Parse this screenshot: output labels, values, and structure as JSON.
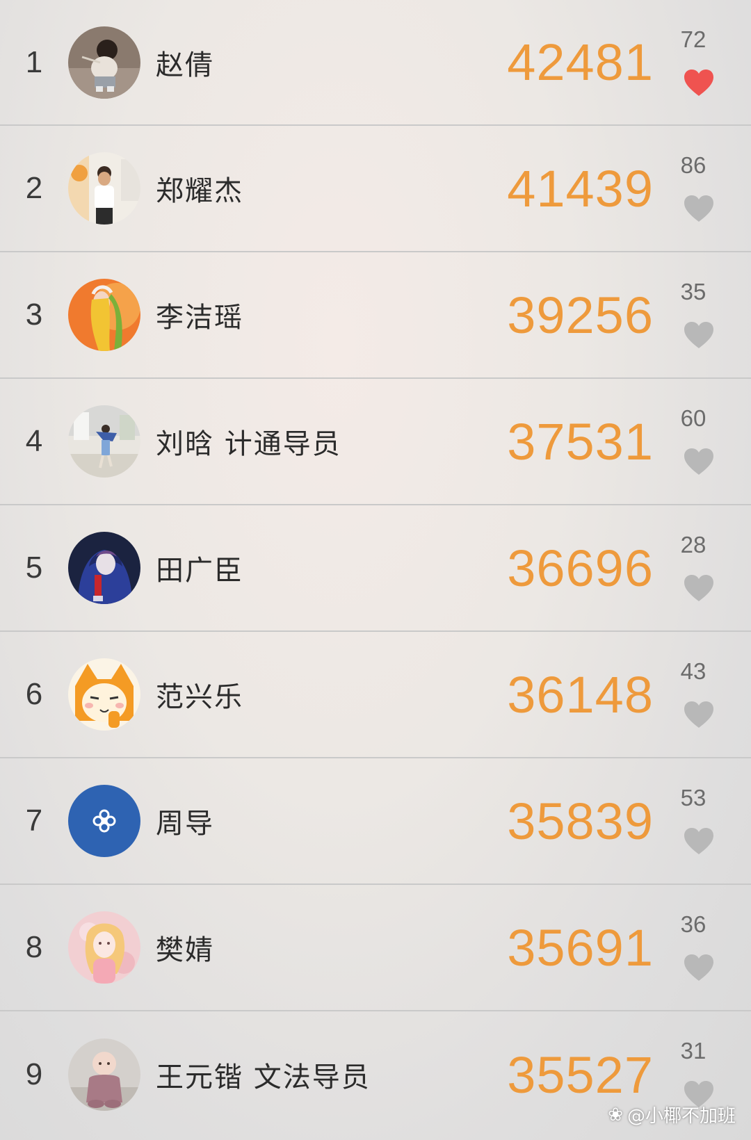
{
  "colors": {
    "score": "#ee9a3c",
    "heart_liked": "#ef5350",
    "heart_default": "#b8b8b8"
  },
  "leaderboard": [
    {
      "rank": "1",
      "name": "赵倩",
      "score": "42481",
      "likes": "72",
      "liked": true,
      "avatar": "toddler-photo"
    },
    {
      "rank": "2",
      "name": "郑耀杰",
      "score": "41439",
      "likes": "86",
      "liked": false,
      "avatar": "man-white-shirt-photo"
    },
    {
      "rank": "3",
      "name": "李洁瑶",
      "score": "39256",
      "likes": "35",
      "liked": false,
      "avatar": "orange-illustration"
    },
    {
      "rank": "4",
      "name": "刘晗 计通导员",
      "score": "37531",
      "likes": "60",
      "liked": false,
      "avatar": "outdoor-jump-photo"
    },
    {
      "rank": "5",
      "name": "田广臣",
      "score": "36696",
      "likes": "28",
      "liked": false,
      "avatar": "blue-hoodie-anime"
    },
    {
      "rank": "6",
      "name": "范兴乐",
      "score": "36148",
      "likes": "43",
      "liked": false,
      "avatar": "orange-cartoon-fox"
    },
    {
      "rank": "7",
      "name": "周导",
      "score": "35839",
      "likes": "53",
      "liked": false,
      "avatar": "blue-logo"
    },
    {
      "rank": "8",
      "name": "樊婧",
      "score": "35691",
      "likes": "36",
      "liked": false,
      "avatar": "pink-girl-illustration"
    },
    {
      "rank": "9",
      "name": "王元锴 文法导员",
      "score": "35527",
      "likes": "31",
      "liked": false,
      "avatar": "baby-photo"
    }
  ],
  "watermark": {
    "text": "@小椰不加班"
  }
}
